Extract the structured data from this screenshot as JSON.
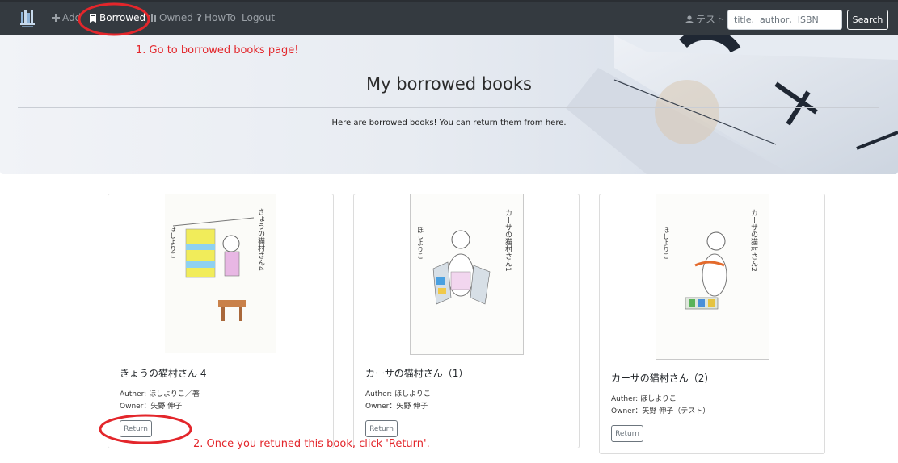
{
  "navbar": {
    "brand_icon": "books-logo-icon",
    "items": [
      {
        "label": "Add",
        "icon": "plus-icon"
      },
      {
        "label": "Borrowed",
        "icon": "book-icon",
        "active": true
      },
      {
        "label": "Owned",
        "icon": "shelf-icon"
      },
      {
        "label": "HowTo",
        "icon": "question-icon"
      },
      {
        "label": "Logout",
        "icon": ""
      }
    ],
    "user": {
      "label": "テスト",
      "icon": "user-icon"
    },
    "search": {
      "placeholder": "title,  author,  ISBN",
      "button_label": "Search"
    }
  },
  "hero": {
    "title": "My borrowed books",
    "lead": "Here are borrowed books! You can return them from here."
  },
  "books": [
    {
      "title": "きょうの猫村さん 4",
      "author_line": "Auther: ほしよりこ／著",
      "owner_line": "Owner：矢野 伸子",
      "return_label": "Return"
    },
    {
      "title": "カーサの猫村さん（1）",
      "author_line": "Auther: ほしよりこ",
      "owner_line": "Owner：矢野 伸子",
      "return_label": "Return"
    },
    {
      "title": "カーサの猫村さん（2）",
      "author_line": "Auther: ほしよりこ",
      "owner_line": "Owner：矢野 伸子（テスト）",
      "return_label": "Return"
    }
  ],
  "annotations": {
    "step1": "1. Go to borrowed books page!",
    "step2": "2. Once you retuned this book, click 'Return'.",
    "color": "#e3262b"
  },
  "colors": {
    "navbar": "#343a40",
    "nav_text": "#9aa0a6",
    "annotation": "#e3262b"
  }
}
